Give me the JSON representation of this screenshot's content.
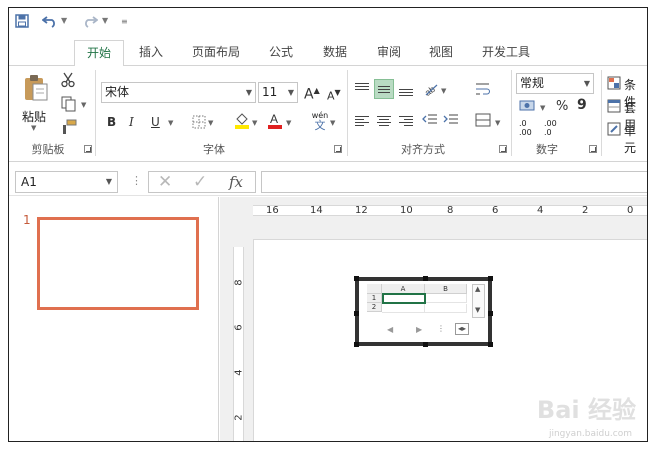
{
  "ribbon_tabs": [
    "开始",
    "插入",
    "页面布局",
    "公式",
    "数据",
    "审阅",
    "视图",
    "开发工具"
  ],
  "clipboard": {
    "paste_label": "粘贴",
    "group_label": "剪贴板"
  },
  "font": {
    "name": "宋体",
    "size": "11",
    "group_label": "字体",
    "bold": "B",
    "italic": "I",
    "underline": "U",
    "grow": "A",
    "shrink": "A",
    "phonetic_top": "wén",
    "phonetic_bottom": "文"
  },
  "alignment": {
    "group_label": "对齐方式"
  },
  "number": {
    "format": "常规",
    "percent": "%",
    "comma": "9",
    "group_label": "数字",
    "inc_decimal_top": ".0",
    "inc_decimal_bottom": ".00",
    "dec_decimal_top": ".00",
    "dec_decimal_bottom": ".0"
  },
  "styles": {
    "cond_format": "条件",
    "table_format": "套用",
    "cell_styles": "单元"
  },
  "formula_bar": {
    "name_box": "A1",
    "fx": "fx",
    "cancel": "✕",
    "enter": "✓"
  },
  "thumbnail": {
    "number": "1"
  },
  "ruler": {
    "h_ticks": [
      "16",
      "14",
      "12",
      "10",
      "8",
      "6",
      "4",
      "2",
      "0"
    ],
    "v_ticks": [
      "8",
      "6",
      "4",
      "2"
    ]
  },
  "embedded": {
    "col_a": "A",
    "col_b": "B",
    "row_1": "1",
    "row_2": "2"
  },
  "watermark": {
    "brand": "Bai 经验",
    "url": "jingyan.baidu.com"
  },
  "colors": {
    "accent": "#217346",
    "thumb_border": "#e0704f",
    "font_color": "#e02020",
    "highlight": "#ffe800"
  }
}
